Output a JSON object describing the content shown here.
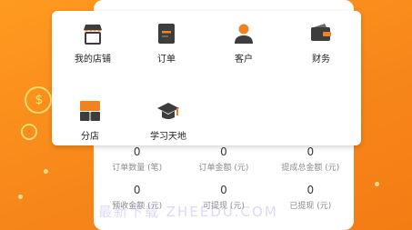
{
  "menu": {
    "items": [
      {
        "label": "我的店铺",
        "icon": "storefront-icon"
      },
      {
        "label": "订单",
        "icon": "order-document-icon"
      },
      {
        "label": "客户",
        "icon": "customer-person-icon"
      },
      {
        "label": "财务",
        "icon": "wallet-icon"
      },
      {
        "label": "分店",
        "icon": "branch-blocks-icon"
      },
      {
        "label": "学习天地",
        "icon": "graduation-cap-icon"
      }
    ]
  },
  "stats": {
    "row1": [
      {
        "value": "0",
        "label": "订单数量 (笔)"
      },
      {
        "value": "0",
        "label": "订单金额 (元)"
      },
      {
        "value": "0",
        "label": "提成总金额 (元)"
      }
    ],
    "row2": [
      {
        "value": "0",
        "label": "预收金额 (元)"
      },
      {
        "value": "0",
        "label": "可提现 (元)"
      },
      {
        "value": "0",
        "label": "已提现 (元)"
      }
    ]
  },
  "watermark": "最新下载 ZHEEDU.COM",
  "colors": {
    "accent": "#f7871a",
    "icon_dark": "#3d3d3d",
    "icon_orange": "#f2821d"
  }
}
